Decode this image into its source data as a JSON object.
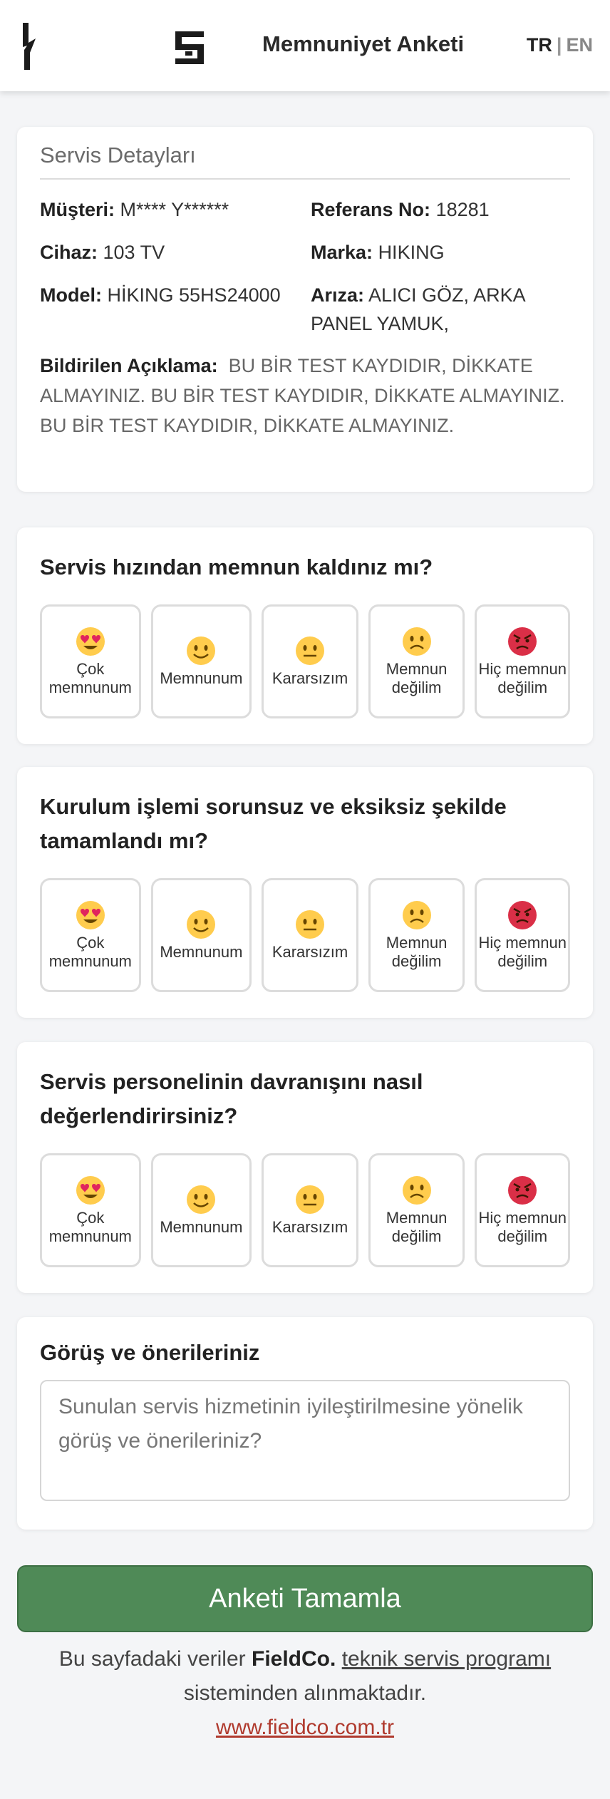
{
  "header": {
    "title": "Memnuniyet Anketi",
    "lang_tr": "TR",
    "lang_sep": "|",
    "lang_en": "EN"
  },
  "details": {
    "title": "Servis Detayları",
    "customer_label": "Müşteri:",
    "customer_value": "M**** Y******",
    "ref_label": "Referans No:",
    "ref_value": "18281",
    "device_label": "Cihaz:",
    "device_value": "103 TV",
    "brand_label": "Marka:",
    "brand_value": "HIKING",
    "model_label": "Model:",
    "model_value": "HİKING 55HS24000",
    "fault_label": "Arıza:",
    "fault_value": "ALICI GÖZ, ARKA PANEL YAMUK,",
    "desc_label": "Bildirilen Açıklama:",
    "desc_value": "BU BİR TEST KAYDIDIR, DİKKATE ALMAYINIZ. BU BİR TEST KAYDIDIR, DİKKATE ALMAYINIZ. BU BİR TEST KAYDIDIR, DİKKATE ALMAYINIZ."
  },
  "options": {
    "o1": "Çok memnunum",
    "o2": "Memnunum",
    "o3": "Kararsızım",
    "o4": "Memnun değilim",
    "o5": "Hiç memnun değilim"
  },
  "icons": {
    "o1": "heart-eyes-emoji",
    "o2": "smile-emoji",
    "o3": "neutral-emoji",
    "o4": "frown-emoji",
    "o5": "angry-emoji"
  },
  "questions": {
    "q1": "Servis hızından memnun kaldınız mı?",
    "q2": "Kurulum işlemi sorunsuz ve eksiksiz şekilde tamamlandı mı?",
    "q3": "Servis personelinin davranışını nasıl değerlendirirsiniz?"
  },
  "feedback": {
    "title": "Görüş ve önerileriniz",
    "placeholder": "Sunulan servis hizmetinin iyileştirilmesine yönelik görüş ve önerileriniz?"
  },
  "submit_label": "Anketi Tamamla",
  "footer": {
    "text1": "Bu sayfadaki veriler",
    "brand": "FieldCo.",
    "link_text": "teknik servis programı",
    "text2": "sisteminden alınmaktadır.",
    "url": "www.fieldco.com.tr"
  },
  "colors": {
    "submit_bg": "#4f8a57",
    "link": "#b03a2e"
  }
}
